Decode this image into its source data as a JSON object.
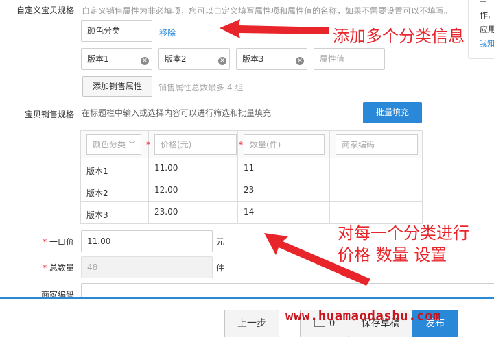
{
  "custom_props": {
    "label": "自定义宝贝规格",
    "hint": "自定义销售属性为非必填项，您可以自定义填写属性项和属性值的名称，如果不需要设置可以不填写。",
    "group_name_value": "颜色分类",
    "remove_link": "移除",
    "values": [
      "版本1",
      "版本2",
      "版本3"
    ],
    "value_placeholder": "属性值",
    "add_button": "添加销售属性",
    "limit_hint": "销售属性总数最多 4 组"
  },
  "side_panel": {
    "line1": "作,",
    "line2": "应用",
    "link": "我知"
  },
  "sku": {
    "label": "宝贝销售规格",
    "hint": "在标题栏中输入或选择内容可以进行筛选和批量填充",
    "batch_button": "批量填充",
    "headers": {
      "color_select": "颜色分类",
      "price": "价格(元)",
      "quantity": "数量(件)",
      "merchant_code": "商家编码"
    },
    "rows": [
      {
        "name": "版本1",
        "price": "11.00",
        "qty": "11"
      },
      {
        "name": "版本2",
        "price": "12.00",
        "qty": "23"
      },
      {
        "name": "版本3",
        "price": "23.00",
        "qty": "14"
      }
    ]
  },
  "price": {
    "label": "一口价",
    "value": "11.00",
    "unit": "元"
  },
  "total": {
    "label": "总数量",
    "value": "48",
    "unit": "件"
  },
  "merchant_code": {
    "label": "商家编码"
  },
  "annotations": {
    "top": "添加多个分类信息",
    "bottom_line1": "对每一个分类进行",
    "bottom_line2": "价格 数量 设置"
  },
  "footer": {
    "prev_button": "上一步",
    "mail_count": "0",
    "save_draft": "保存草稿",
    "publish": "发布"
  },
  "watermark": "www.huamaodashu.com",
  "colors": {
    "accent": "#2a88d8",
    "annotation": "#e8252b",
    "required": "#e60012"
  }
}
